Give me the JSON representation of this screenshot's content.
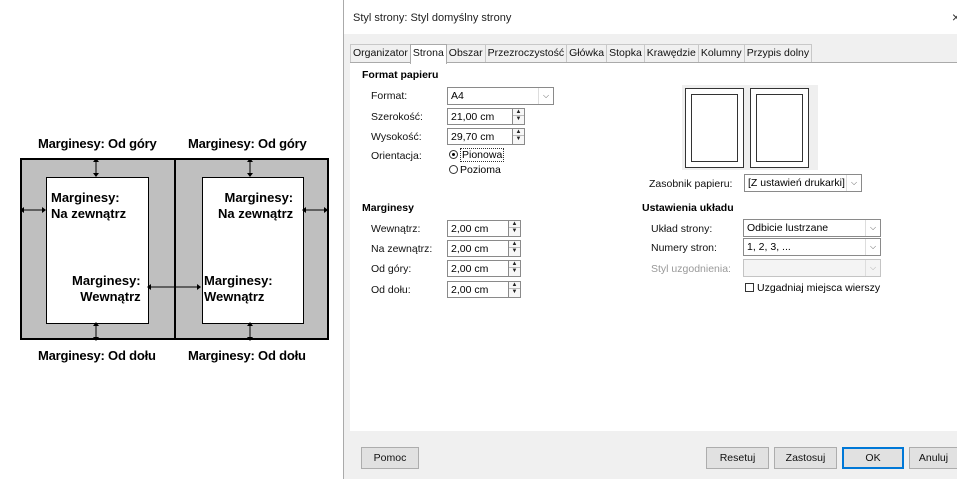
{
  "diagram": {
    "top_left": "Marginesy: Od góry",
    "top_right": "Marginesy: Od góry",
    "bottom_left": "Marginesy: Od dołu",
    "bottom_right": "Marginesy: Od dołu",
    "left_outer_line1": "Marginesy:",
    "left_outer_line2": "Na zewnątrz",
    "right_outer_line1": "Marginesy:",
    "right_outer_line2": "Na zewnątrz",
    "left_inner_line1": "Marginesy:",
    "left_inner_line2": "Wewnątrz",
    "right_inner_line1": "Marginesy:",
    "right_inner_line2": "Wewnątrz"
  },
  "dialog": {
    "title": "Styl strony: Styl domyślny strony",
    "close": "×",
    "tabs": [
      "Organizator",
      "Strona",
      "Obszar",
      "Przezroczystość",
      "Główka",
      "Stopka",
      "Krawędzie",
      "Kolumny",
      "Przypis dolny"
    ],
    "active_tab": "Strona",
    "paper": {
      "heading": "Format papieru",
      "format_label": "Format:",
      "format_value": "A4",
      "width_label": "Szerokość:",
      "width_value": "21,00 cm",
      "height_label": "Wysokość:",
      "height_value": "29,70 cm",
      "orientation_label": "Orientacja:",
      "portrait": "Pionowa",
      "landscape": "Pozioma",
      "tray_label": "Zasobnik papieru:",
      "tray_value": "[Z ustawień drukarki]"
    },
    "margins": {
      "heading": "Marginesy",
      "inner_label": "Wewnątrz:",
      "inner_value": "2,00 cm",
      "outer_label": "Na zewnątrz:",
      "outer_value": "2,00 cm",
      "top_label": "Od góry:",
      "top_value": "2,00 cm",
      "bottom_label": "Od dołu:",
      "bottom_value": "2,00 cm"
    },
    "layout": {
      "heading": "Ustawienia układu",
      "page_layout_label": "Układ strony:",
      "page_layout_value": "Odbicie lustrzane",
      "page_numbers_label": "Numery stron:",
      "page_numbers_value": "1, 2, 3, ...",
      "reference_style_label": "Styl uzgodnienia:",
      "reference_style_value": "",
      "register_true": "Uzgadniaj miejsca wierszy"
    },
    "buttons": {
      "help": "Pomoc",
      "reset": "Resetuj",
      "apply": "Zastosuj",
      "ok": "OK",
      "cancel": "Anuluj"
    }
  }
}
